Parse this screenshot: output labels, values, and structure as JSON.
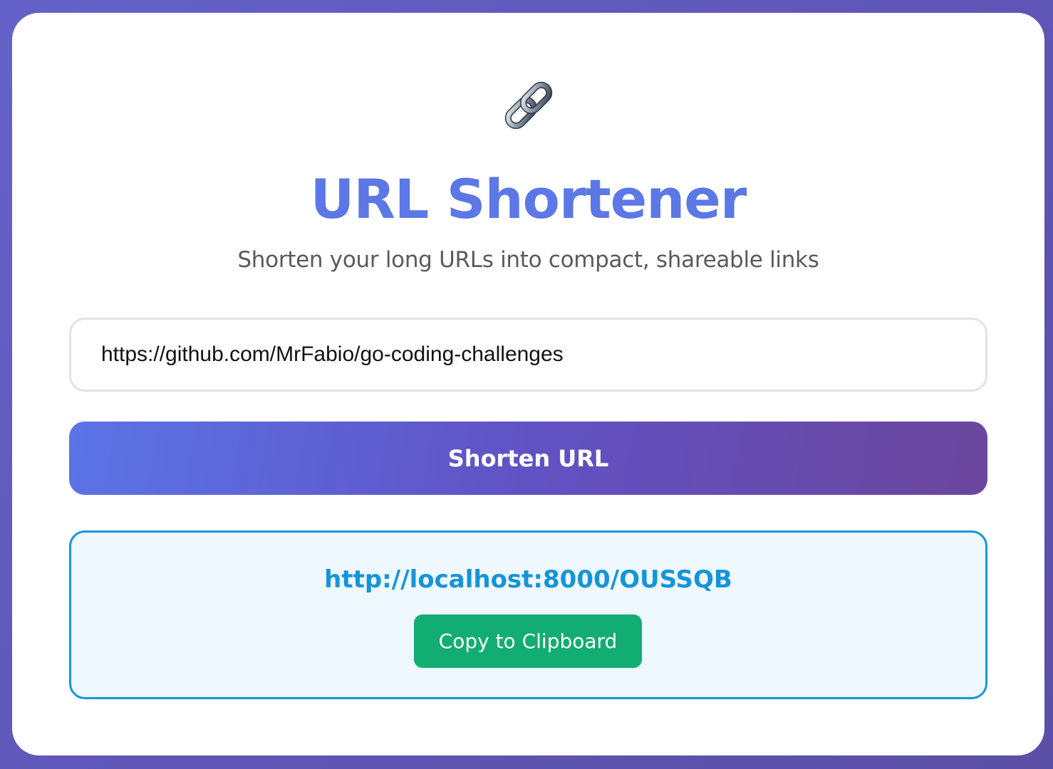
{
  "header": {
    "icon": "link-chain-icon",
    "title": "URL Shortener",
    "subtitle": "Shorten your long URLs into compact, shareable links"
  },
  "form": {
    "url_value": "https://github.com/MrFabio/go-coding-challenges",
    "submit_label": "Shorten URL"
  },
  "result": {
    "short_url": "http://localhost:8000/OUSSQB",
    "copy_label": "Copy to Clipboard"
  },
  "colors": {
    "title": "#5c77e6",
    "link": "#1594da",
    "copy_button": "#12ad72",
    "result_border": "#1597db",
    "result_background": "#eef8fe"
  }
}
